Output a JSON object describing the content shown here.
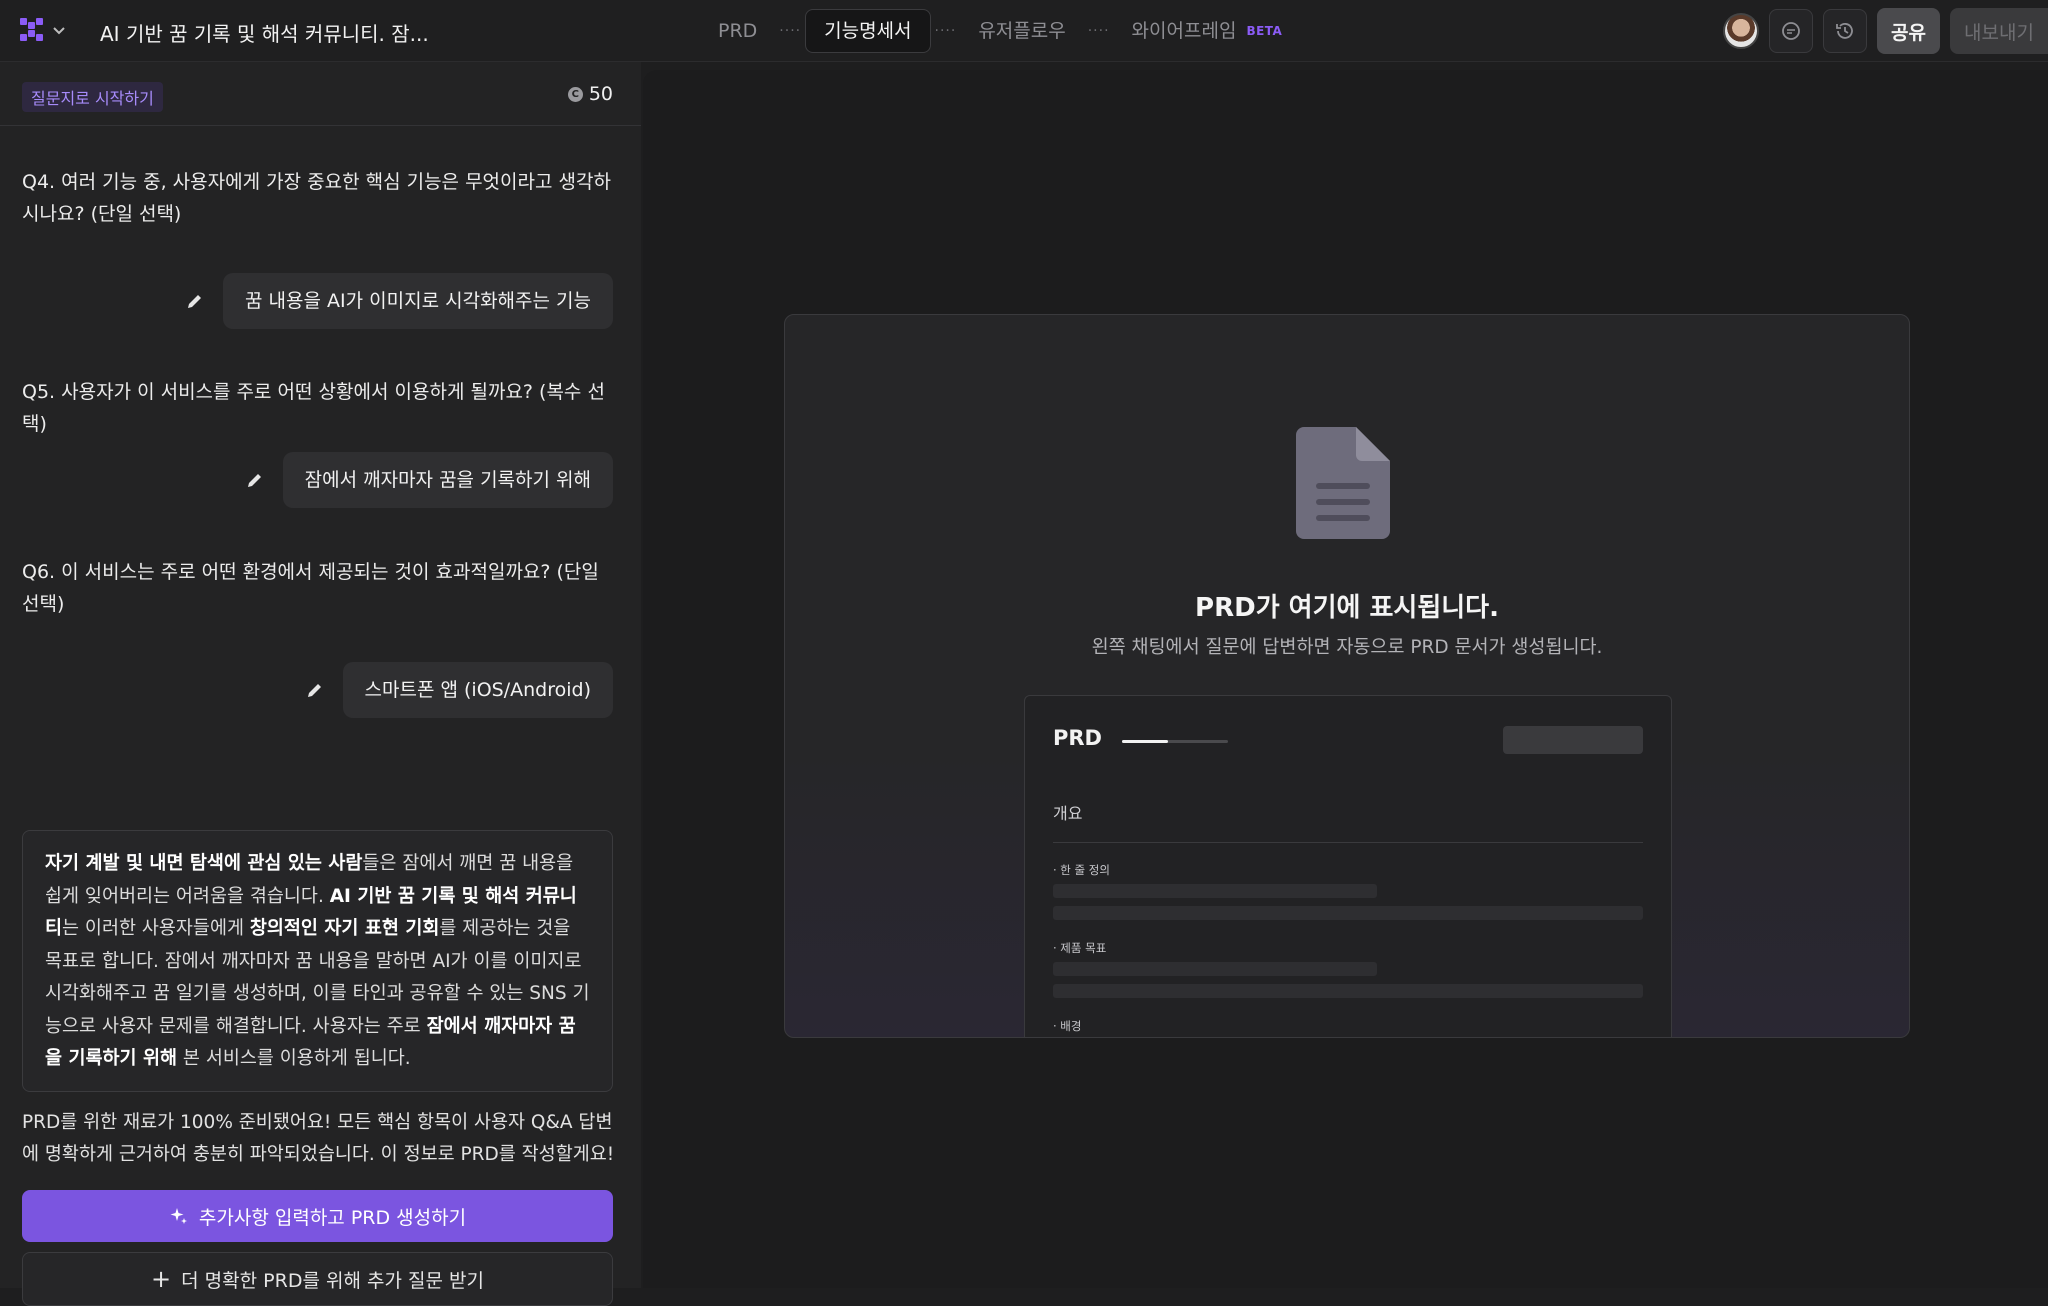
{
  "header": {
    "doc_title": "AI 기반 꿈 기록 및 해석 커뮤니티. 잠...",
    "steps": [
      {
        "label": "PRD",
        "active": false
      },
      {
        "label": "기능명세서",
        "active": true
      },
      {
        "label": "유저플로우",
        "active": false
      },
      {
        "label": "와이어프레임",
        "badge": "BETA",
        "active": false
      }
    ],
    "step_separator": "····",
    "share_label": "공유",
    "export_label": "내보내기"
  },
  "left": {
    "start_tag": "질문지로 시작하기",
    "credits": "50",
    "credits_icon": "C",
    "qa": [
      {
        "question": "Q4. 여러 기능 중, 사용자에게 가장 중요한 핵심 기능은 무엇이라고 생각하시나요? (단일 선택)",
        "answer": "꿈 내용을 AI가 이미지로 시각화해주는 기능"
      },
      {
        "question": "Q5. 사용자가 이 서비스를 주로 어떤 상황에서 이용하게 될까요? (복수 선택)",
        "answer": "잠에서 깨자마자 꿈을 기록하기 위해"
      },
      {
        "question": "Q6. 이 서비스는 주로 어떤 환경에서 제공되는 것이 효과적일까요? (단일 선택)",
        "answer": "스마트폰 앱 (iOS/Android)"
      }
    ],
    "summary": {
      "b1": "자기 계발 및 내면 탐색에 관심 있는 사람",
      "t1": "들은 잠에서 깨면 꿈 내용을 쉽게 잊어버리는 어려움을 겪습니다. ",
      "b2": "AI 기반 꿈 기록 및 해석 커뮤니티",
      "t2": "는 이러한 사용자들에게 ",
      "b3": "창의적인 자기 표현 기회",
      "t3": "를 제공하는 것을 목표로 합니다. 잠에서 깨자마자 꿈 내용을 말하면 AI가 이를 이미지로 시각화해주고 꿈 일기를 생성하며, 이를 타인과 공유할 수 있는 SNS 기능으로 사용자 문제를 해결합니다. 사용자는 주로 ",
      "b4": "잠에서 깨자마자 꿈을 기록하기 위해",
      "t4": " 본 서비스를 이용하게 됩니다."
    },
    "ready_text": "PRD를 위한 재료가 100% 준비됐어요! 모든 핵심 항목이 사용자 Q&A 답변에 명확하게 근거하여 충분히 파악되었습니다. 이 정보로 PRD를 작성할게요!",
    "primary_button": "추가사항 입력하고 PRD 생성하기",
    "secondary_button": "더 명확한 PRD를 위해 추가 질문 받기",
    "secondary_icon": "+"
  },
  "right": {
    "empty_title": "PRD가 여기에 표시됩니다.",
    "empty_subtitle": "왼쪽 채팅에서 질문에 답변하면 자동으로 PRD 문서가 생성됩니다.",
    "preview": {
      "title": "PRD",
      "progress_fraction": 0.43,
      "section": "개요",
      "labels": [
        "· 한 줄 정의",
        "· 제품 목표",
        "· 배경"
      ]
    }
  },
  "colors": {
    "accent": "#7b55e0",
    "background": "#1e1e1f",
    "panel": "#232324"
  },
  "icons": [
    "app-logo-icon",
    "chevron-down-icon",
    "comment-icon",
    "history-icon",
    "credit-icon",
    "pencil-icon",
    "sparkle-icon",
    "plus-icon",
    "document-icon"
  ]
}
